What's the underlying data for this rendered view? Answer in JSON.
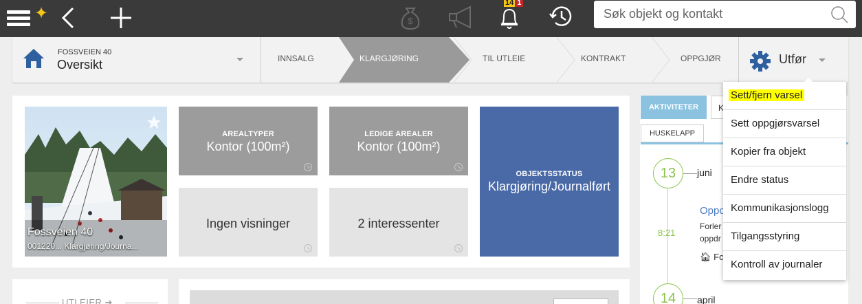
{
  "topbar": {
    "notification_badge_count": "14",
    "notification_badge_alert": "1",
    "search_placeholder": "Søk objekt og kontakt"
  },
  "header": {
    "property_name": "FOSSVEIEN 40",
    "view_name": "Oversikt",
    "steps": [
      "INNSALG",
      "KLARGJØRING",
      "TIL UTLEIE",
      "KONTRAKT",
      "OPPGJØR"
    ],
    "active_step": "KLARGJØRING",
    "action_label": "Utfør"
  },
  "photo": {
    "title": "Fossveien 40",
    "subtitle": "001220... Klargjøring/Journa..."
  },
  "tiles": {
    "arealtyper_label": "AREALTYPER",
    "arealtyper_value": "Kontor (100m²)",
    "ledige_label": "LEDIGE AREALER",
    "ledige_value": "Kontor (100m²)",
    "visninger": "Ingen visninger",
    "interessenter": "2 interessenter",
    "status_label": "OBJEKTSSTATUS",
    "status_value": "Klargjøring/Journalført"
  },
  "lower": {
    "utleier_label": "UTLEIER"
  },
  "activity": {
    "tab_activities": "AKTIVITETER",
    "tab_k": "K",
    "tab_huskelapp": "HUSKELAPP",
    "entries": [
      {
        "day": "13",
        "month": "juni"
      },
      {
        "day": "14",
        "month": "april"
      }
    ],
    "time": "8:21",
    "link_text": "Oppc",
    "line1": "Forler",
    "line2": "oppdr",
    "home_text": "Fc"
  },
  "dropdown": {
    "items": [
      "Sett/fjern varsel",
      "Sett oppgjørsvarsel",
      "Kopier fra objekt",
      "Endre status",
      "Kommunikasjonslogg",
      "Tilgangsstyring",
      "Kontroll av journaler"
    ]
  },
  "colors": {
    "topbar": "#3a3a3a",
    "active_step": "#9a9a9a",
    "status_tile": "#4a6aa7",
    "accent_green": "#8bc34a",
    "tab_blue": "#8ac2e0",
    "highlight": "#ffff00"
  }
}
